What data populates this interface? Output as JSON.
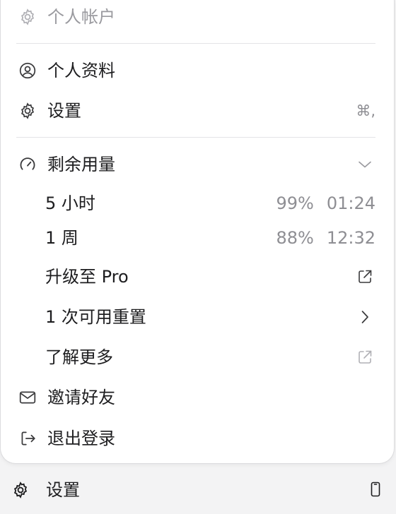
{
  "menu": {
    "header": {
      "icon": "gear-icon",
      "label": "个人帐户"
    },
    "profile": {
      "icon": "person-circle-icon",
      "label": "个人资料"
    },
    "settings": {
      "icon": "gear-icon",
      "label": "设置",
      "shortcut": "⌘,"
    },
    "usage": {
      "icon": "gauge-icon",
      "label": "剩余用量",
      "toggle_icon": "chevron-down-icon",
      "items": [
        {
          "label": "5 小时",
          "percent": "99%",
          "time": "01:24"
        },
        {
          "label": "1 周",
          "percent": "88%",
          "time": "12:32"
        }
      ]
    },
    "upgrade": {
      "label": "升级至 Pro",
      "icon": "external-link-icon"
    },
    "resets": {
      "label": "1 次可用重置",
      "icon": "chevron-right-icon"
    },
    "learn_more": {
      "label": "了解更多",
      "icon": "external-link-icon"
    },
    "invite": {
      "icon": "envelope-icon",
      "label": "邀请好友"
    },
    "logout": {
      "icon": "logout-icon",
      "label": "退出登录"
    }
  },
  "bottom_bar": {
    "settings": {
      "icon": "gear-icon",
      "label": "设置"
    },
    "device_icon": "phone-icon"
  }
}
